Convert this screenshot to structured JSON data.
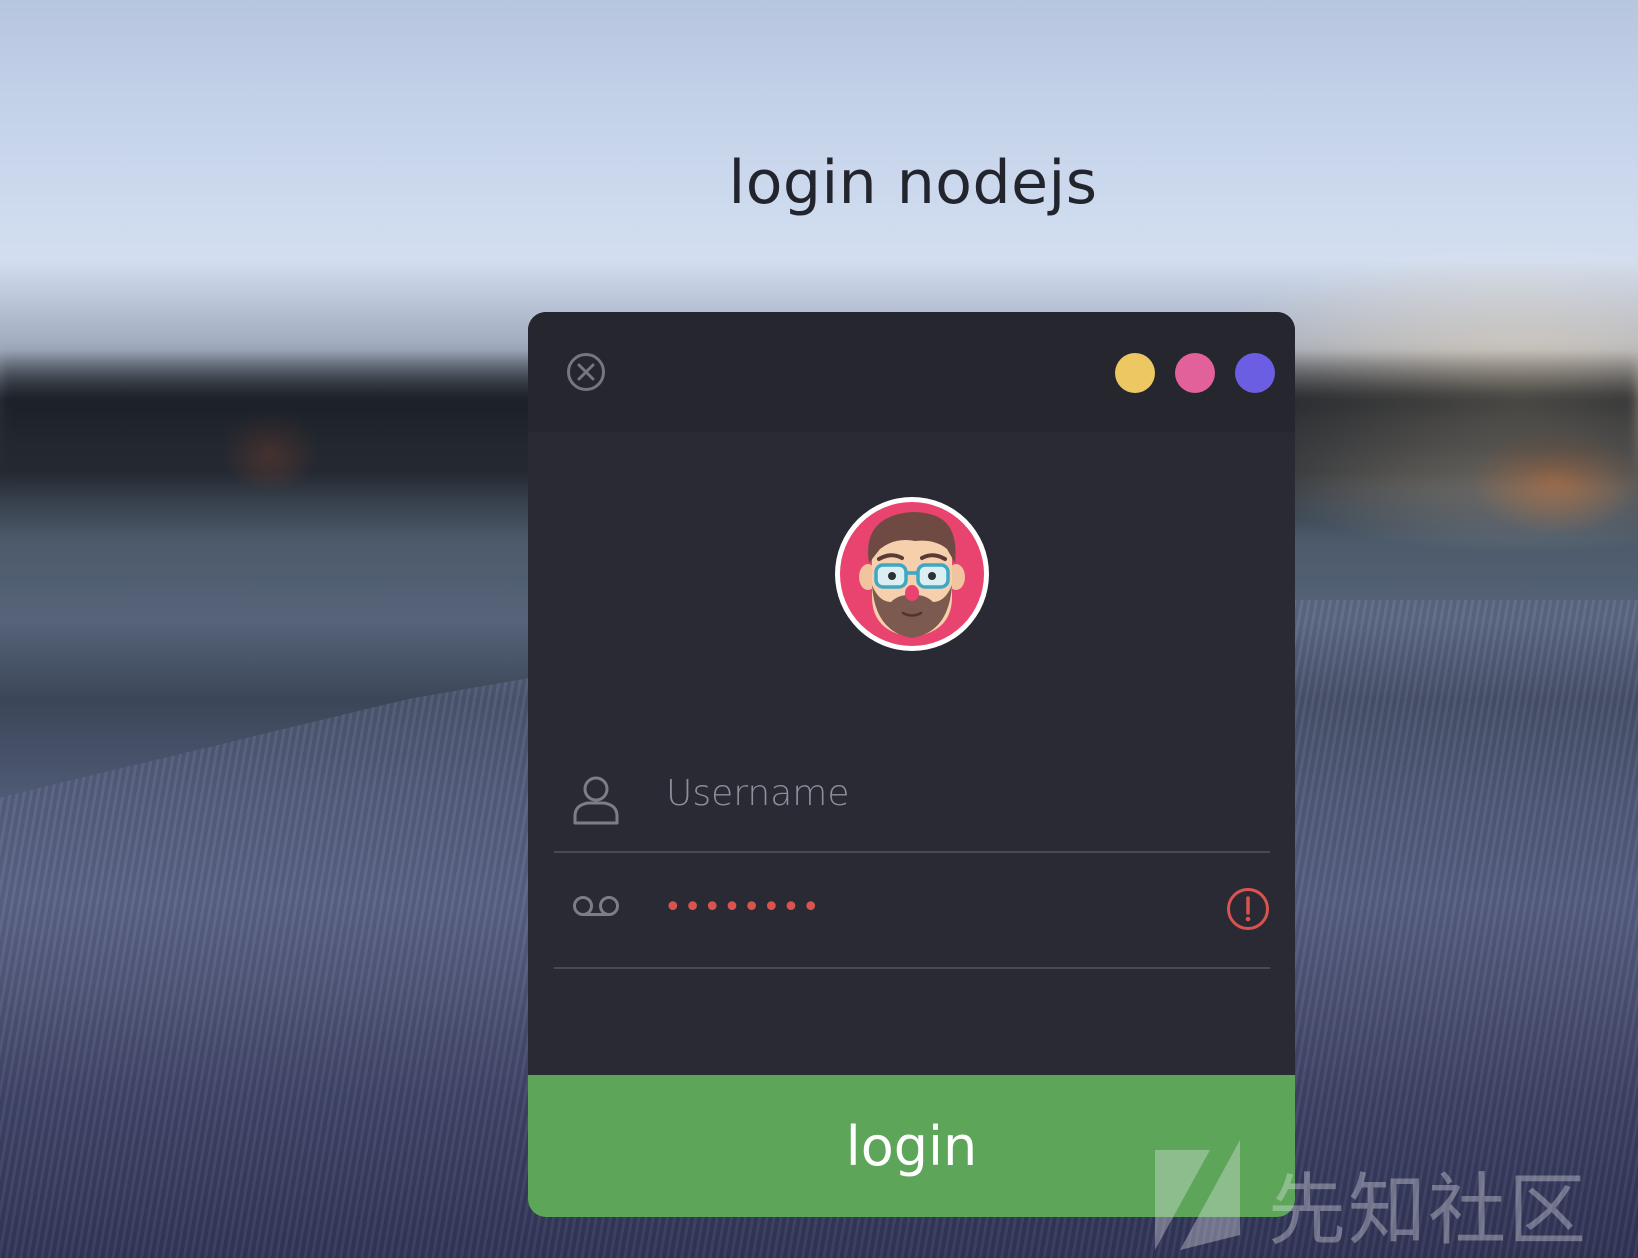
{
  "page": {
    "title": "login nodejs"
  },
  "dialog": {
    "close_icon": "close-circle-icon",
    "theme_dots": [
      {
        "name": "yellow",
        "color": "#edc862"
      },
      {
        "name": "pink",
        "color": "#e2619b"
      },
      {
        "name": "purple",
        "color": "#6b5ee3"
      }
    ],
    "avatar": "bearded-man-with-glasses-avatar",
    "username": {
      "icon": "user-icon",
      "placeholder": "Username",
      "value": ""
    },
    "password": {
      "icon": "voicemail-icon",
      "masked_value": "••••••••",
      "status_icon": "exclamation-circle-icon",
      "status_color": "#d9534f"
    },
    "login_button": {
      "label": "login",
      "color": "#5da559"
    }
  },
  "watermark": {
    "text": "先知社区"
  }
}
